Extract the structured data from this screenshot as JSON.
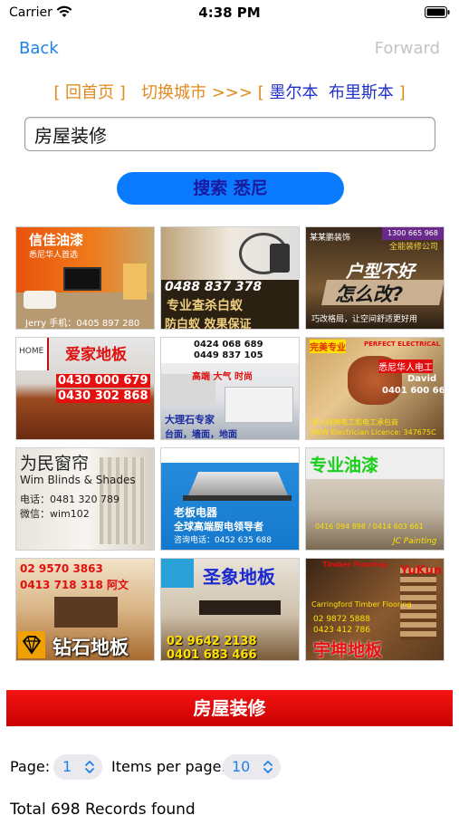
{
  "status": {
    "carrier": "Carrier",
    "time": "4:38 PM"
  },
  "nav": {
    "back": "Back",
    "forward": "Forward"
  },
  "city_row": {
    "home_link": "[ 回首页 ]",
    "switch_city": "切换城市 >>>",
    "bracket_open": "[",
    "city_1": "墨尔本",
    "city_2": "布里斯本",
    "bracket_close": "]"
  },
  "search": {
    "value": "房屋装修",
    "button": "搜索 悉尼"
  },
  "ads": [
    {
      "name": "ad-xinjia-paint",
      "texts": [
        "信佳油漆",
        "悉尼华人首选",
        "Jerry 手机：0405 897 280"
      ]
    },
    {
      "name": "ad-termite",
      "texts": [
        "0488 837 378",
        "专业查杀白蚁",
        "防白蚁  效果保证"
      ]
    },
    {
      "name": "ad-renovation",
      "texts": [
        "某某鹏装饰",
        "1300 665 968",
        "全能装修公司",
        "户型不好",
        "怎么改?",
        "巧改格局，让空间舒适更好用"
      ]
    },
    {
      "name": "ad-aijia-floor",
      "texts": [
        "HOME",
        "爱家地板",
        "0430 000 679",
        "0430 302 868"
      ]
    },
    {
      "name": "ad-marble",
      "texts": [
        "0424 068 689",
        "0449 837 105",
        "高端 大气 时尚",
        "大理石专家",
        "台面，墙面，地面"
      ]
    },
    {
      "name": "ad-electrician",
      "texts": [
        "完美专业",
        "PERFECT ELECTRICAL",
        "悉尼华人电工",
        "David",
        "0401 600 660",
        "华人持牌电工和电工承包商",
        "NSW Electrician Licence: 347675C"
      ]
    },
    {
      "name": "ad-blinds",
      "texts": [
        "为民窗帘",
        "Wim Blinds & Shades",
        "电话：0481 320 789",
        "微信：wim102"
      ]
    },
    {
      "name": "ad-rangehood",
      "texts": [
        "老板电器",
        "全球高端厨电领导者",
        "咨询电话：0452 635 688"
      ]
    },
    {
      "name": "ad-pro-paint",
      "texts": [
        "专业油漆",
        "0416 094 898 / 0414 603 661",
        "JC Painting"
      ]
    },
    {
      "name": "ad-diamond-floor",
      "texts": [
        "02 9570 3863",
        "0413 718 318 阿文",
        "钻石地板"
      ]
    },
    {
      "name": "ad-elephant-floor",
      "texts": [
        "圣象地板",
        "02 9642 2138",
        "0401 683 466"
      ]
    },
    {
      "name": "ad-yukun-floor",
      "texts": [
        "Timber Flooring",
        "YuKun",
        "Carringford Timber Flooring",
        "02 9872 5888",
        "0423 412 786",
        "宇坤地板"
      ]
    }
  ],
  "category_title": "房屋装修",
  "pagination": {
    "page_label": "Page:",
    "page_value": "1",
    "per_page_label": "Items per page:",
    "per_page_value": "10"
  },
  "records_text": "Total 698 Records found",
  "colors": {
    "link_blue": "#1a82e8",
    "button_blue": "#0a7bff",
    "banner_red": "#e60f0f",
    "city_orange": "#e08a1e"
  }
}
